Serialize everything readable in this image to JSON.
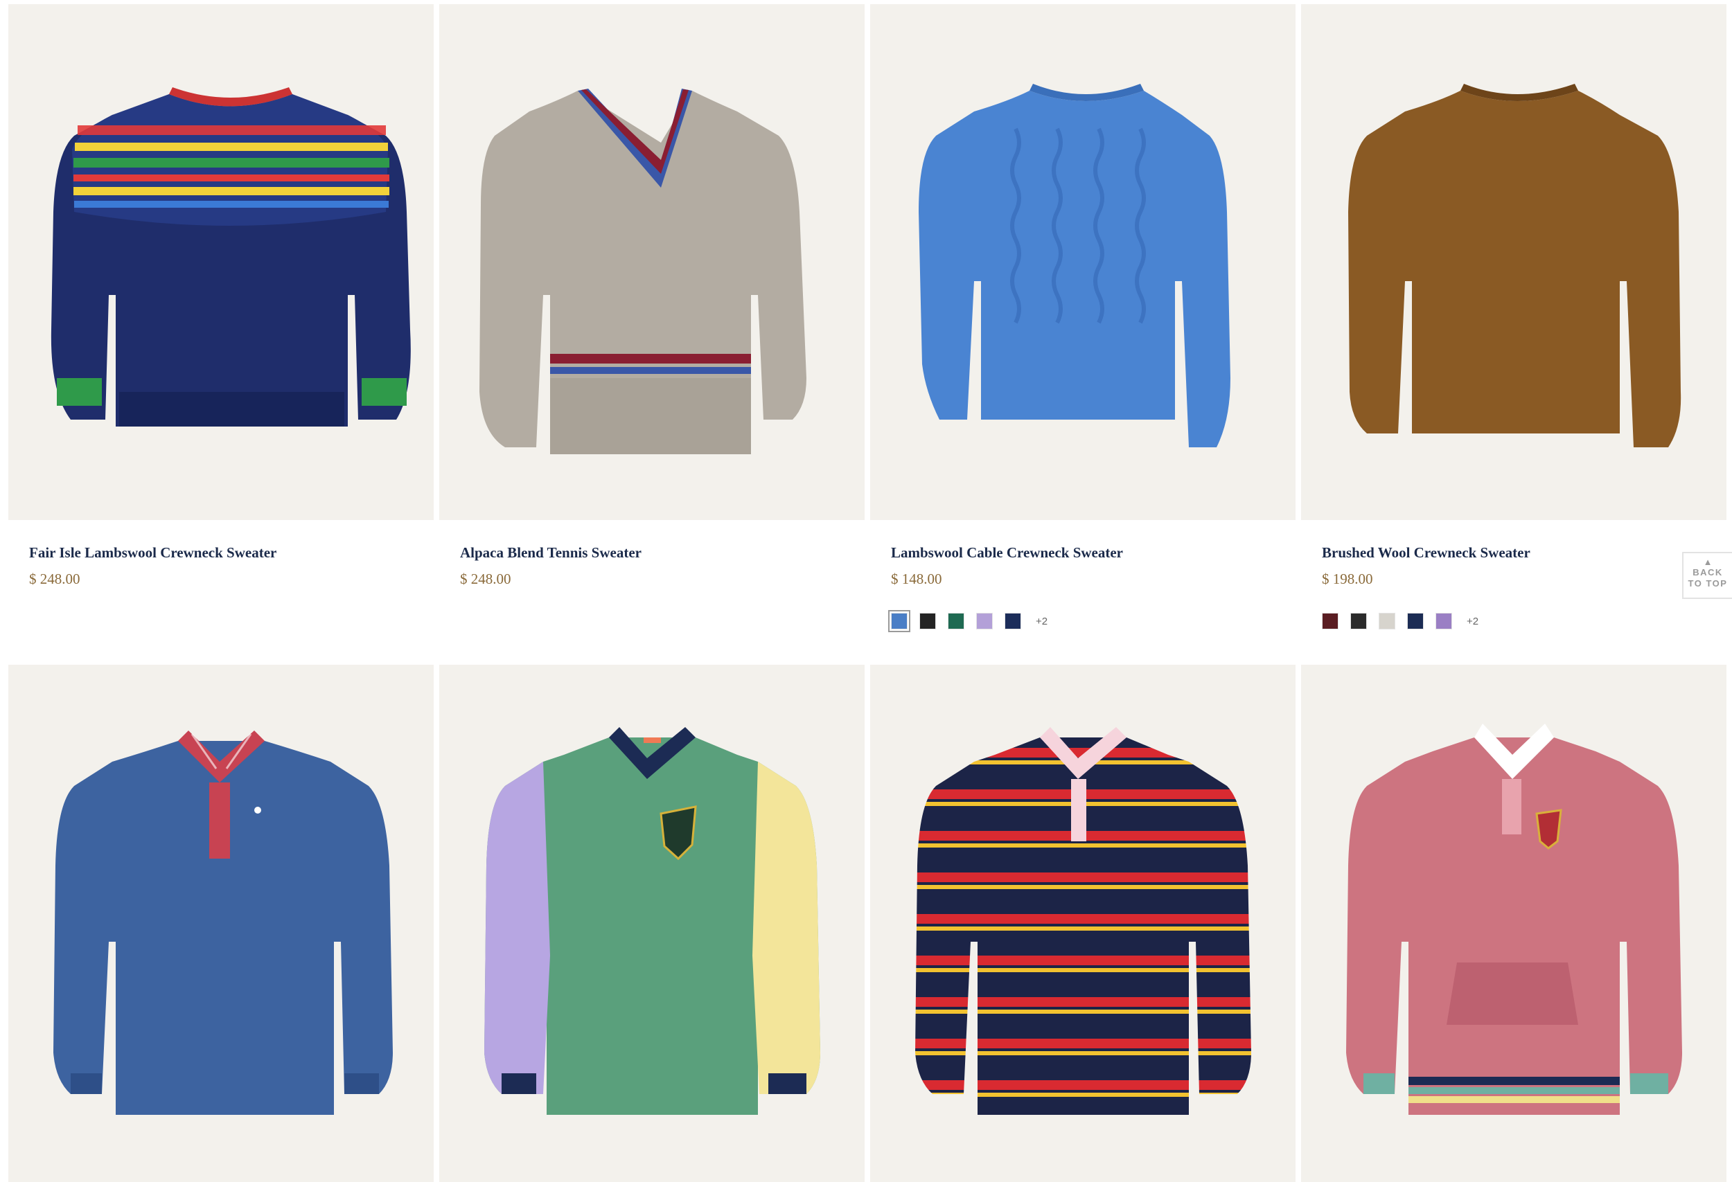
{
  "products": [
    {
      "title": "Fair Isle Lambswool Crewneck Sweater",
      "price": "$ 248.00",
      "image": "navy fair-isle crewneck sweater"
    },
    {
      "title": "Alpaca Blend Tennis Sweater",
      "price": "$ 248.00",
      "image": "oatmeal tennis v-neck sweater"
    },
    {
      "title": "Lambswool Cable Crewneck Sweater",
      "price": "$ 148.00",
      "image": "blue cable-knit crewneck sweater",
      "swatches": [
        "#4a7ec6",
        "#242424",
        "#1f6a52",
        "#b3a0d8",
        "#1c2d5a"
      ],
      "more": "+2"
    },
    {
      "title": "Brushed Wool Crewneck Sweater",
      "price": "$ 198.00",
      "image": "brown brushed wool crewneck sweater",
      "swatches": [
        "#5a1d22",
        "#2b2b2b",
        "#d7d4cd",
        "#1c2c54",
        "#9a7fc4"
      ],
      "more": "+2"
    },
    {
      "image": "blue rugby shirt with plaid collar"
    },
    {
      "image": "colorblock green rugby shirt with crest"
    },
    {
      "image": "navy red yellow striped rugby shirt"
    },
    {
      "image": "rose pink rugby hoodie with striped hem"
    }
  ],
  "back_to_top": {
    "arrow": "▲",
    "line1": "BACK",
    "line2": "TO TOP"
  }
}
